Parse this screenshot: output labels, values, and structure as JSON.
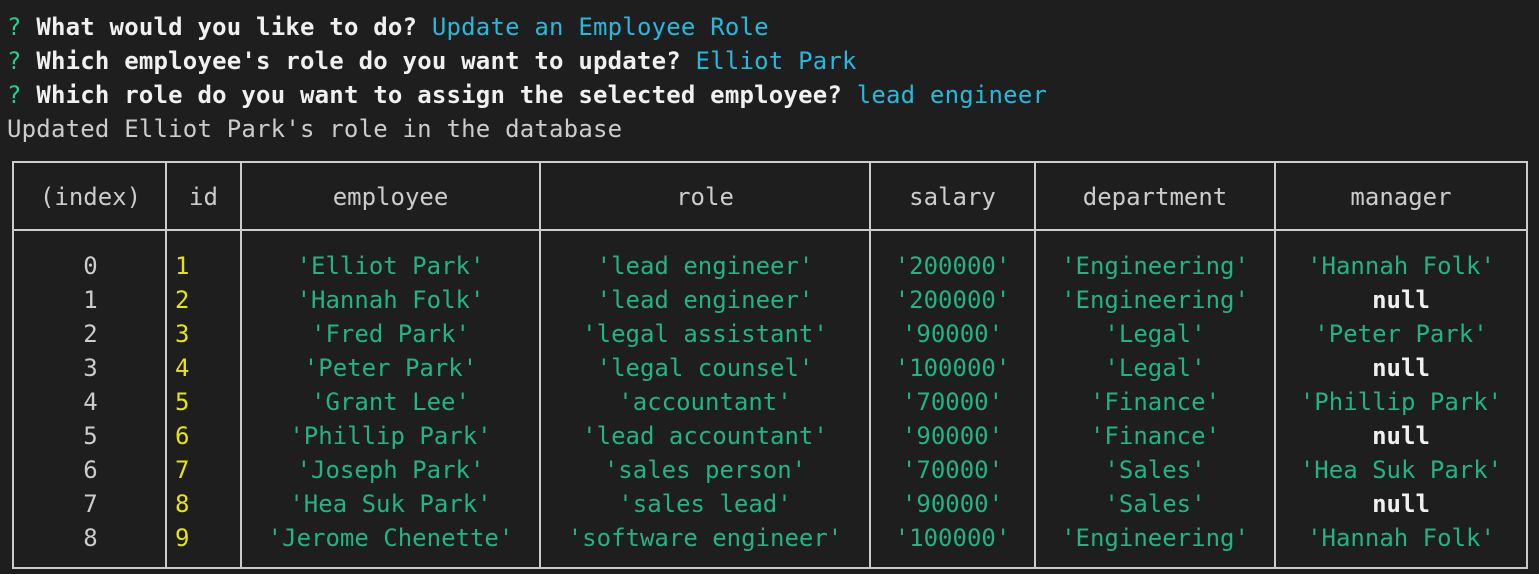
{
  "prompts": [
    {
      "mark": "?",
      "question": "What would you like to do?",
      "answer": "Update an Employee Role"
    },
    {
      "mark": "?",
      "question": "Which employee's role do you want to update?",
      "answer": "Elliot Park"
    },
    {
      "mark": "?",
      "question": "Which role do you want to assign the selected employee?",
      "answer": "lead engineer"
    }
  ],
  "status_message": "Updated Elliot Park's role in the database",
  "table": {
    "headers": [
      "(index)",
      "id",
      "employee",
      "role",
      "salary",
      "department",
      "manager"
    ],
    "rows": [
      [
        "0",
        "1",
        "'Elliot Park'",
        "'lead engineer'",
        "'200000'",
        "'Engineering'",
        "'Hannah Folk'"
      ],
      [
        "1",
        "2",
        "'Hannah Folk'",
        "'lead engineer'",
        "'200000'",
        "'Engineering'",
        "null"
      ],
      [
        "2",
        "3",
        "'Fred Park'",
        "'legal assistant'",
        "'90000'",
        "'Legal'",
        "'Peter Park'"
      ],
      [
        "3",
        "4",
        "'Peter Park'",
        "'legal counsel'",
        "'100000'",
        "'Legal'",
        "null"
      ],
      [
        "4",
        "5",
        "'Grant Lee'",
        "'accountant'",
        "'70000'",
        "'Finance'",
        "'Phillip Park'"
      ],
      [
        "5",
        "6",
        "'Phillip Park'",
        "'lead accountant'",
        "'90000'",
        "'Finance'",
        "null"
      ],
      [
        "6",
        "7",
        "'Joseph Park'",
        "'sales person'",
        "'70000'",
        "'Sales'",
        "'Hea Suk Park'"
      ],
      [
        "7",
        "8",
        "'Hea Suk Park'",
        "'sales lead'",
        "'90000'",
        "'Sales'",
        "null"
      ],
      [
        "8",
        "9",
        "'Jerome Chenette'",
        "'software engineer'",
        "'100000'",
        "'Engineering'",
        "'Hannah Folk'"
      ]
    ]
  },
  "colors": {
    "background": "#1e1e1e",
    "prompt_mark": "#23d18b",
    "answer": "#29b8db",
    "string_value": "#23b384",
    "id_value": "#e5e510",
    "null_value": "#f0f0f0",
    "border": "#cccccc"
  }
}
